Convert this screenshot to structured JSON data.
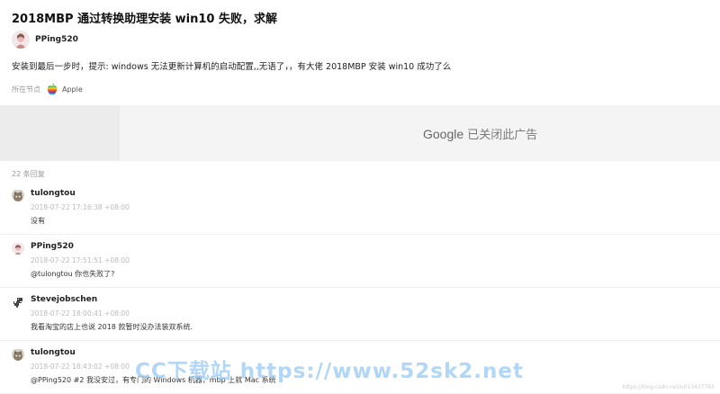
{
  "topic": {
    "title": "2018MBP 通过转换助理安装 win10 失败，求解",
    "author": "PPing520",
    "content": "安装到最后一步时，提示: windows 无法更新计算机的启动配置,,无语了，，有大佬 2018MBP 安装 win10 成功了么",
    "node_prefix": "所在节点",
    "node_name": "Apple",
    "node_icon": "apple-logo-icon"
  },
  "ad": {
    "google": "Google",
    "text": "已关闭此广告"
  },
  "reply_count": "22 条回复",
  "replies": [
    {
      "user": "tulongtou",
      "time": "2018-07-22 17:16:38 +08:00",
      "text": "没有",
      "avatar": "cat-avatar"
    },
    {
      "user": "PPing520",
      "time": "2018-07-22 17:51:51 +08:00",
      "text": "@tulongtou 你也失败了?",
      "avatar": "person-avatar"
    },
    {
      "user": "Stevejobschen",
      "time": "2018-07-22 18:00:41 +08:00",
      "text": "我看淘宝的店上也说 2018 款暂时没办法装双系统.",
      "avatar": "dinosaur-avatar"
    },
    {
      "user": "tulongtou",
      "time": "2018-07-22 18:43:02 +08:00",
      "text": "@PPing520 #2 我没安过，有专门的 Windows 机器，mbp 上就 Mac 系统",
      "avatar": "cat-avatar"
    }
  ],
  "watermark": "CC下载站 https://www.52sk2.net",
  "credit": "https://blog.csdn.net/u013437765",
  "colors": {
    "ad_bg": "#f4f4f4",
    "watermark": "#96c8f5",
    "accent": "#222222"
  }
}
